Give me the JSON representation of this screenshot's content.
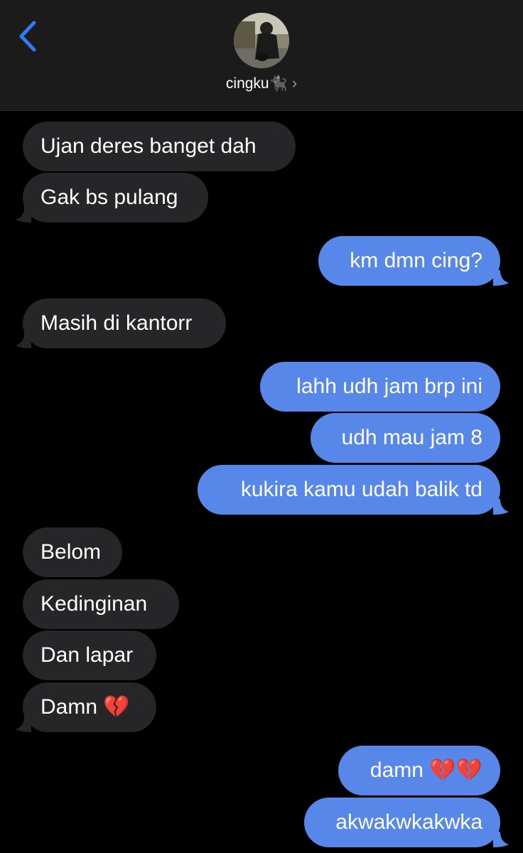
{
  "header": {
    "contact_name": "cingku🐈‍⬛",
    "chevron": "›",
    "back_icon": "chevron-left-icon",
    "accent": "#2f7bf6"
  },
  "colors": {
    "incoming_bubble": "#262628",
    "outgoing_bubble": "#5787e9",
    "background": "#000000"
  },
  "messages": [
    {
      "dir": "in",
      "text": "Ujan deres banget dah"
    },
    {
      "dir": "in",
      "text": "Gak bs pulang"
    },
    {
      "dir": "out",
      "text": "km dmn cing?"
    },
    {
      "dir": "in",
      "text": "Masih di kantorr"
    },
    {
      "dir": "out",
      "text": "lahh udh jam brp ini"
    },
    {
      "dir": "out",
      "text": "udh mau jam 8"
    },
    {
      "dir": "out",
      "text": "kukira kamu udah balik td"
    },
    {
      "dir": "in",
      "text": "Belom"
    },
    {
      "dir": "in",
      "text": "Kedinginan"
    },
    {
      "dir": "in",
      "text": "Dan lapar"
    },
    {
      "dir": "in",
      "text": "Damn 💔"
    },
    {
      "dir": "out",
      "text": "damn 💔💔"
    },
    {
      "dir": "out",
      "text": "akwakwkakwka"
    }
  ]
}
